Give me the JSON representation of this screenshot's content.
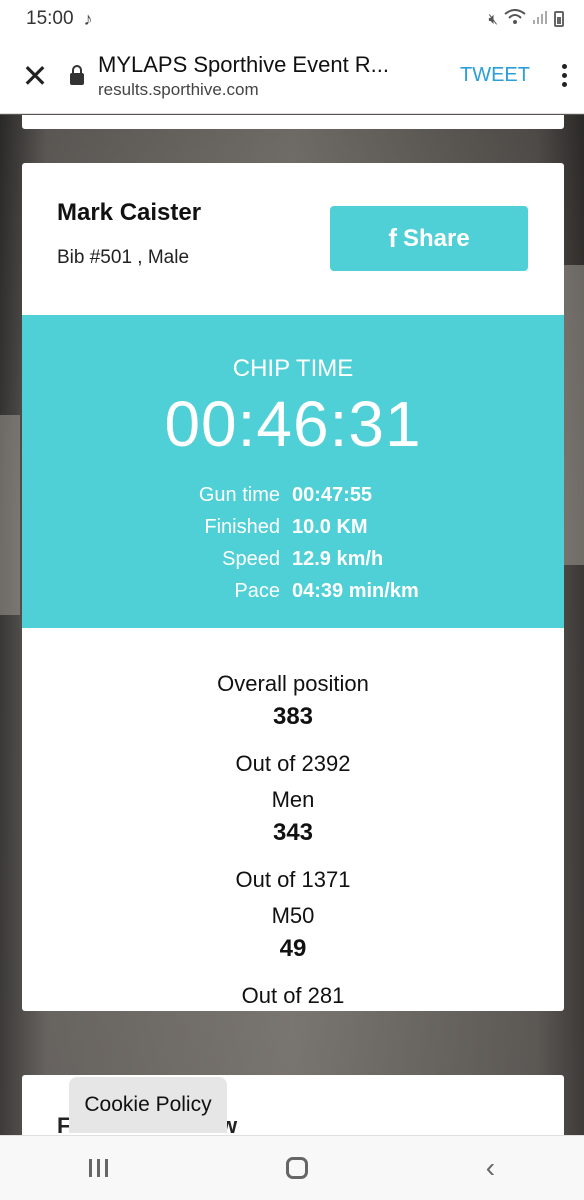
{
  "status_bar": {
    "time": "15:00",
    "icons": [
      "music-note-icon",
      "mute-icon",
      "wifi-icon",
      "signal-icon",
      "battery-icon"
    ]
  },
  "browser": {
    "close_icon": "close-icon",
    "title": "MYLAPS Sporthive Event R...",
    "url": "results.sporthive.com",
    "tweet_label": "TWEET",
    "menu_icon": "more-vert-icon"
  },
  "athlete": {
    "name": "Mark Caister",
    "meta": "Bib #501 , Male"
  },
  "share": {
    "icon": "facebook-icon",
    "label": "Share",
    "color": "#4fcfd6"
  },
  "timing": {
    "chip_label": "CHIP TIME",
    "chip_time": "00:46:31",
    "panel_color": "#4fd0d6",
    "stats": [
      {
        "label": "Gun time",
        "value": "00:47:55"
      },
      {
        "label": "Finished",
        "value": "10.0 KM"
      },
      {
        "label": "Speed",
        "value": "12.9 km/h"
      },
      {
        "label": "Pace",
        "value": "04:39 min/km"
      }
    ]
  },
  "positions": [
    {
      "label": "Overall position",
      "value": "383",
      "out_of": "Out of 2392"
    },
    {
      "label": "Men",
      "value": "343",
      "out_of": "Out of 1371"
    },
    {
      "label": "M50",
      "value": "49",
      "out_of": "Out of 281"
    }
  ],
  "next_card": {
    "partial_left": "F",
    "partial_right": "w"
  },
  "cookie": {
    "label": "Cookie Policy"
  },
  "nav_bar": {
    "icons": [
      "recent-apps-icon",
      "home-icon",
      "back-icon"
    ]
  }
}
